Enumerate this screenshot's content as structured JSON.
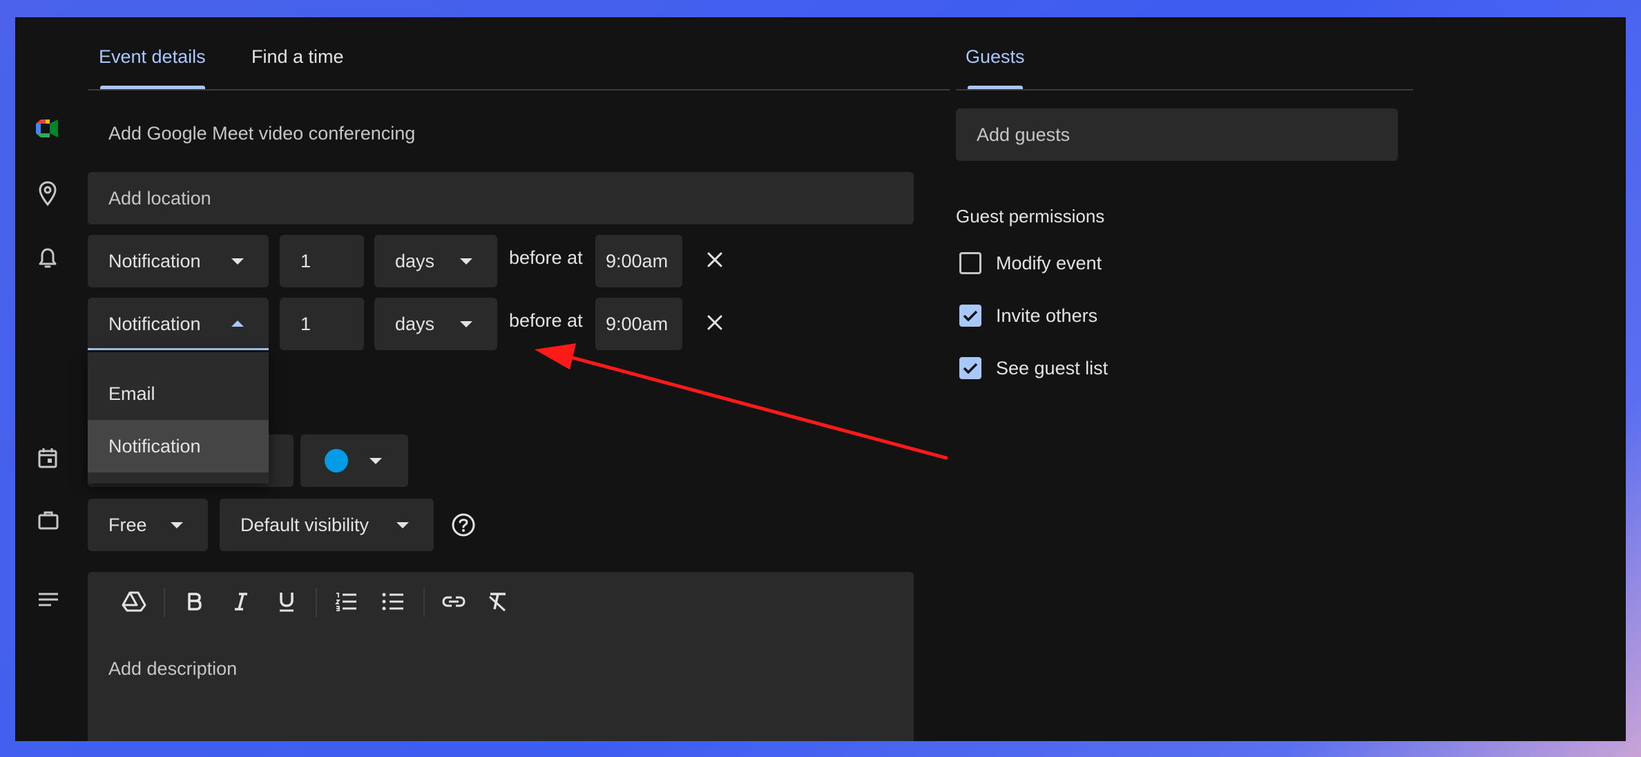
{
  "tabs": {
    "event_details": "Event details",
    "find_a_time": "Find a time",
    "guests": "Guests"
  },
  "meet": {
    "label": "Add Google Meet video conferencing"
  },
  "location": {
    "placeholder": "Add location"
  },
  "notifications": [
    {
      "type": "Notification",
      "amount": "1",
      "unit": "days",
      "before_text": "before at",
      "time": "9:00am"
    },
    {
      "type": "Notification",
      "amount": "1",
      "unit": "days",
      "before_text": "before at",
      "time": "9:00am"
    }
  ],
  "notification_type_menu": {
    "options": [
      "Email",
      "Notification"
    ],
    "selected": "Notification"
  },
  "calendar": {
    "color": "#039be5"
  },
  "availability": {
    "label": "Free"
  },
  "visibility": {
    "label": "Default visibility"
  },
  "description": {
    "placeholder": "Add description"
  },
  "guests_panel": {
    "add_guests_placeholder": "Add guests",
    "permissions_title": "Guest permissions",
    "permissions": [
      {
        "label": "Modify event",
        "checked": false
      },
      {
        "label": "Invite others",
        "checked": true
      },
      {
        "label": "See guest list",
        "checked": true
      }
    ]
  },
  "annotation": {
    "arrow_color": "#ff1a1a"
  },
  "colors": {
    "accent": "#a8c7fa",
    "background": "#131313",
    "field": "#2a2a2a"
  }
}
